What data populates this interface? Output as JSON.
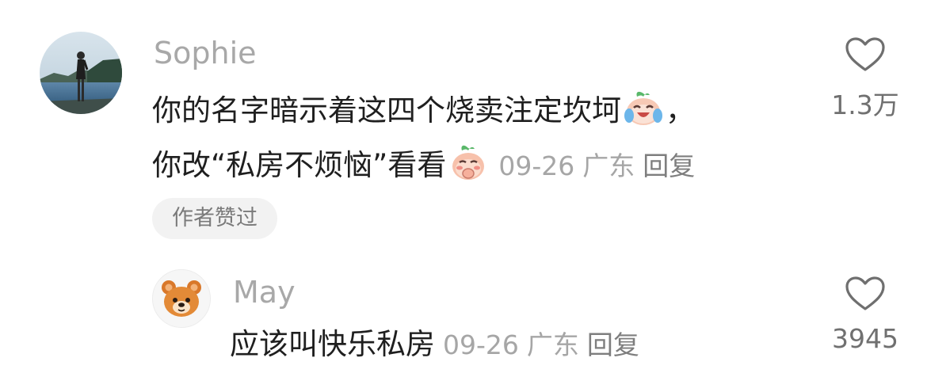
{
  "comment1": {
    "username": "Sophie",
    "line1": "你的名字暗示着这四个烧卖注定坎坷",
    "line1_end": "，",
    "line2": "你改“私房不烦恼”看看",
    "date": "09-26",
    "location": "广东",
    "reply_label": "回复",
    "author_badge": "作者赞过",
    "like_count": "1.3万",
    "emoji1": "crying-laughing-peach-emoji",
    "emoji2": "shy-peach-emoji"
  },
  "comment2": {
    "username": "May",
    "text": "应该叫快乐私房",
    "date": "09-26",
    "location": "广东",
    "reply_label": "回复",
    "like_count": "3945",
    "avatar_icon": "bear-face-icon"
  },
  "colors": {
    "username": "#a8a8a8",
    "text": "#1f1f1f",
    "meta": "#a6a6a6",
    "badge_bg": "#f2f2f2",
    "heart": "#6f6f6f"
  }
}
